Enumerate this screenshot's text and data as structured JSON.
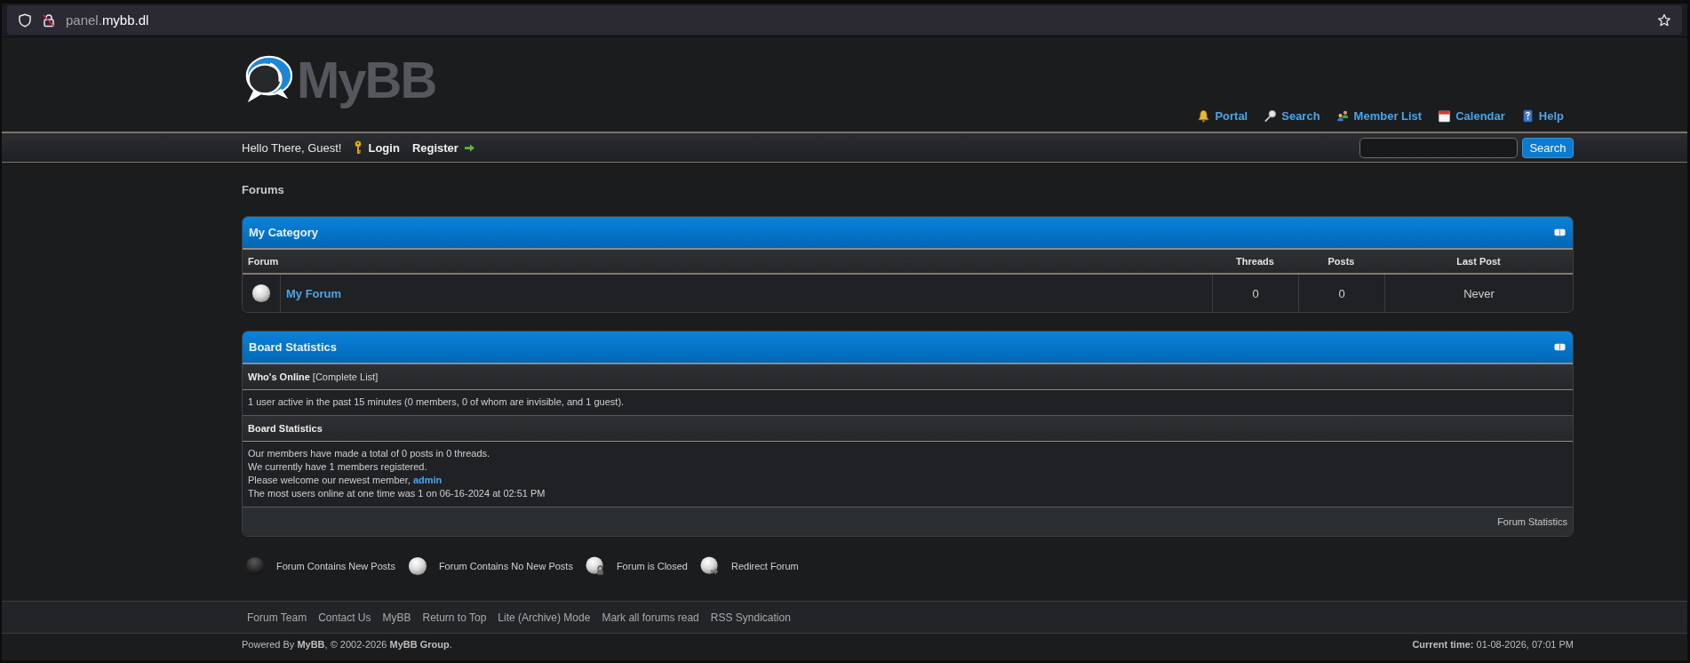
{
  "browser": {
    "address": {
      "subdomain": "panel.",
      "domain": "mybb.dl"
    }
  },
  "header": {
    "logo_text": "MyBB",
    "menu": [
      {
        "label": "Portal",
        "kind": "portal"
      },
      {
        "label": "Search",
        "kind": "search"
      },
      {
        "label": "Member List",
        "kind": "members"
      },
      {
        "label": "Calendar",
        "kind": "calendar"
      },
      {
        "label": "Help",
        "kind": "help"
      }
    ]
  },
  "panel": {
    "greeting": "Hello There, Guest!",
    "links": [
      {
        "label": "Login",
        "kind": "login"
      },
      {
        "label": "Register",
        "kind": "register"
      }
    ],
    "search_button": "Search"
  },
  "breadcrumb": "Forums",
  "category": {
    "title": "My Category",
    "expanded": true,
    "columns": [
      "Forum",
      "Threads",
      "Posts",
      "Last Post"
    ],
    "forums": [
      {
        "name": "My Forum",
        "kind": "no_new",
        "threads": "0",
        "posts": "0",
        "last_post": "Never"
      }
    ]
  },
  "board_statistics": {
    "title": "Board Statistics",
    "expanded": true,
    "sections": [
      {
        "heading": "Who's Online",
        "heading_link": "[Complete List]",
        "lines": [
          {
            "text": "1 user active in the past 15 minutes (0 members, 0 of whom are invisible, and 1 guest)."
          }
        ]
      },
      {
        "heading": "Board Statistics",
        "lines": [
          {
            "text": "Our members have made a total of 0 posts in 0 threads."
          },
          {
            "text": "We currently have 1 members registered."
          },
          {
            "text": "Please welcome our newest member, ",
            "link": "admin"
          },
          {
            "text": "The most users online at one time was 1 on 06-16-2024 at 02:51 PM"
          }
        ]
      }
    ],
    "footer_link": "Forum Statistics"
  },
  "legend": [
    {
      "label": "Forum Contains New Posts",
      "kind": "new"
    },
    {
      "label": "Forum Contains No New Posts",
      "kind": "no_new"
    },
    {
      "label": "Forum is Closed",
      "kind": "closed"
    },
    {
      "label": "Redirect Forum",
      "kind": "redirect"
    }
  ],
  "footer": {
    "links": [
      "Forum Team",
      "Contact Us",
      "MyBB",
      "Return to Top",
      "Lite (Archive) Mode",
      "Mark all forums read",
      "RSS Syndication"
    ],
    "copyright": "Powered By **MyBB**, © 2002-2026 **MyBB Group**.",
    "current_time": "**Current time:** 01-08-2026, 07:01 PM"
  }
}
